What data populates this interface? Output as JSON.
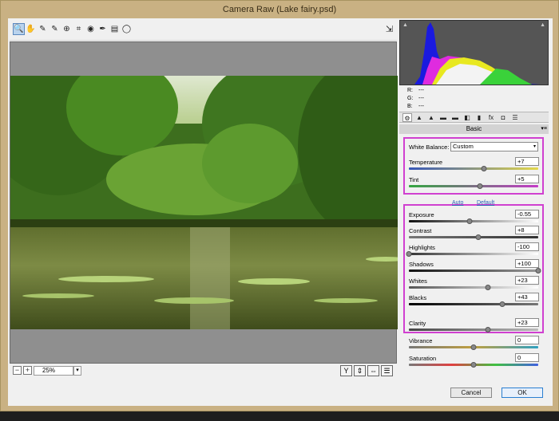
{
  "window": {
    "title": "Camera Raw (Lake fairy.psd)"
  },
  "toolbar": {
    "tools": [
      {
        "name": "zoom-tool",
        "glyph": "🔍",
        "active": true
      },
      {
        "name": "hand-tool",
        "glyph": "✋"
      },
      {
        "name": "white-balance-tool",
        "glyph": "✎"
      },
      {
        "name": "color-sampler-tool",
        "glyph": "✎"
      },
      {
        "name": "targeted-adjustment-tool",
        "glyph": "⊕"
      },
      {
        "name": "crop-tool",
        "glyph": "⌗"
      },
      {
        "name": "red-eye-tool",
        "glyph": "◉"
      },
      {
        "name": "adjustment-brush-tool",
        "glyph": "✒"
      },
      {
        "name": "graduated-filter-tool",
        "glyph": "▤"
      },
      {
        "name": "radial-filter-tool",
        "glyph": "◯"
      }
    ],
    "fullscreen_glyph": "⇲"
  },
  "bottombar": {
    "zoom_out": "−",
    "zoom_in": "+",
    "zoom": "25%",
    "zoom_arrow": "▾",
    "view_buttons": [
      "Y",
      "⇕",
      "⇔",
      "☰"
    ]
  },
  "readout": {
    "r_label": "R:",
    "r_value": "---",
    "g_label": "G:",
    "g_value": "---",
    "b_label": "B:",
    "b_value": "---"
  },
  "panel_tabs": [
    "⚙",
    "▲",
    "▲",
    "▬",
    "▬",
    "◧",
    "▮",
    "fx",
    "◘",
    "☰"
  ],
  "panel": {
    "title": "Basic",
    "menu_glyph": "▾≡"
  },
  "white_balance": {
    "label": "White Balance:",
    "value": "Custom",
    "arrow": "▾"
  },
  "links": {
    "auto": "Auto",
    "default": "Default"
  },
  "sliders": [
    {
      "id": "temperature",
      "label": "Temperature",
      "value": "+7",
      "pos": 0.58,
      "track": "linear-gradient(to right,#3656b8,#e3d84a)"
    },
    {
      "id": "tint",
      "label": "Tint",
      "value": "+5",
      "pos": 0.55,
      "track": "linear-gradient(to right,#33a640,#c43ac7)"
    },
    {
      "id": "exposure",
      "label": "Exposure",
      "value": "-0.55",
      "pos": 0.47,
      "track": "linear-gradient(to right,#111,#fff)"
    },
    {
      "id": "contrast",
      "label": "Contrast",
      "value": "+8",
      "pos": 0.54,
      "track": "linear-gradient(to right,#777,#333)"
    },
    {
      "id": "highlights",
      "label": "Highlights",
      "value": "-100",
      "pos": 0.0,
      "track": "linear-gradient(to right,#333,#fff)"
    },
    {
      "id": "shadows",
      "label": "Shadows",
      "value": "+100",
      "pos": 1.0,
      "track": "linear-gradient(to right,#111,#999)"
    },
    {
      "id": "whites",
      "label": "Whites",
      "value": "+23",
      "pos": 0.61,
      "track": "linear-gradient(to right,#555,#fff)"
    },
    {
      "id": "blacks",
      "label": "Blacks",
      "value": "+43",
      "pos": 0.72,
      "track": "linear-gradient(to right,#000,#777)"
    },
    {
      "id": "clarity",
      "label": "Clarity",
      "value": "+23",
      "pos": 0.61,
      "track": "linear-gradient(to right,#444,#bbb)"
    },
    {
      "id": "vibrance",
      "label": "Vibrance",
      "value": "0",
      "pos": 0.5,
      "track": "linear-gradient(to right,#777,#c0a040,#30a0c0)"
    },
    {
      "id": "saturation",
      "label": "Saturation",
      "value": "0",
      "pos": 0.5,
      "track": "linear-gradient(to right,#777,#e04040,#40c040,#4060e0)"
    }
  ],
  "actions": {
    "cancel": "Cancel",
    "ok": "OK"
  },
  "colors": {
    "highlight_box": "#d040d0",
    "ok_border": "#2a7fd1",
    "title_bar": "#c9b183"
  }
}
